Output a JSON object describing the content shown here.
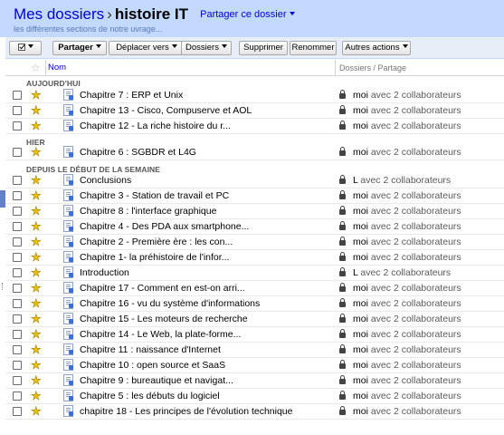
{
  "header": {
    "root_folder": "Mes dossiers",
    "separator": "›",
    "current_folder": "histoire IT",
    "share_folder_label": "Partager ce dossier",
    "description": "les différentes sections de notre uvrage..."
  },
  "toolbar": {
    "select_label": "",
    "share_label": "Partager",
    "move_label": "Déplacer vers",
    "folders_label": "Dossiers",
    "delete_label": "Supprimer",
    "rename_label": "Renommer",
    "more_label": "Autres actions"
  },
  "columns": {
    "name": "Nom",
    "folders_share": "Dossiers / Partage"
  },
  "sections": {
    "today": "AUJOURD'HUI",
    "yesterday": "HIER",
    "week": "DEPUIS LE DÉBUT DE LA SEMAINE"
  },
  "rows": [
    {
      "name": "Chapitre 7 : ERP et Unix",
      "owner": "moi",
      "collaborators": "avec 2 collaborateurs"
    },
    {
      "name": "Chapitre 13 - Cisco, Compuserve et AOL",
      "owner": "moi",
      "collaborators": "avec 2 collaborateurs"
    },
    {
      "name": "Chapitre 12 - La riche histoire du r...",
      "owner": "moi",
      "collaborators": "avec 2 collaborateurs"
    },
    {
      "name": "Chapitre 6 : SGBDR et L4G",
      "owner": "moi",
      "collaborators": "avec 2 collaborateurs"
    },
    {
      "name": "Conclusions",
      "owner": "L",
      "collaborators": "avec 2 collaborateurs"
    },
    {
      "name": "Chapitre 3 - Station de travail et PC",
      "owner": "moi",
      "collaborators": "avec 2 collaborateurs"
    },
    {
      "name": "Chapitre 8 : l'interface graphique",
      "owner": "moi",
      "collaborators": "avec 2 collaborateurs"
    },
    {
      "name": "Chapitre 4 - Des PDA aux smartphone...",
      "owner": "moi",
      "collaborators": "avec 2 collaborateurs"
    },
    {
      "name": "Chapitre 2 - Première ère : les con...",
      "owner": "moi",
      "collaborators": "avec 2 collaborateurs"
    },
    {
      "name": "Chapitre 1- la préhistoire de l'infor...",
      "owner": "moi",
      "collaborators": "avec 2 collaborateurs"
    },
    {
      "name": "Introduction",
      "owner": "L",
      "collaborators": "avec 2 collaborateurs"
    },
    {
      "name": "Chapitre 17 - Comment en est-on arri...",
      "owner": "moi",
      "collaborators": "avec 2 collaborateurs"
    },
    {
      "name": "Chapitre 16 - vu du système d'informations",
      "owner": "moi",
      "collaborators": "avec 2 collaborateurs"
    },
    {
      "name": "Chapitre 15 - Les moteurs de recherche",
      "owner": "moi",
      "collaborators": "avec 2 collaborateurs"
    },
    {
      "name": "Chapitre 14 - Le Web, la plate-forme...",
      "owner": "moi",
      "collaborators": "avec 2 collaborateurs"
    },
    {
      "name": "Chapitre 11 : naissance d'Internet",
      "owner": "moi",
      "collaborators": "avec 2 collaborateurs"
    },
    {
      "name": "Chapitre 10 : open source et SaaS",
      "owner": "moi",
      "collaborators": "avec 2 collaborateurs"
    },
    {
      "name": "Chapitre 9 : bureautique et navigat...",
      "owner": "moi",
      "collaborators": "avec 2 collaborateurs"
    },
    {
      "name": "Chapitre 5 : les débuts du logiciel",
      "owner": "moi",
      "collaborators": "avec 2 collaborateurs"
    },
    {
      "name": "chapitre 18 - Les principes de l'évolution technique",
      "owner": "moi",
      "collaborators": "avec 2 collaborateurs"
    }
  ],
  "colors": {
    "header_bg": "#c3d9ff",
    "link": "#0000cc",
    "star": "#e8c000"
  }
}
